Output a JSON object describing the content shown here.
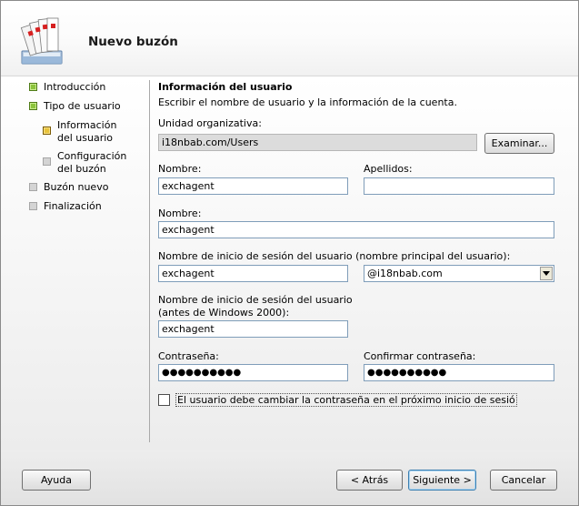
{
  "window": {
    "title": "Nuevo buzón"
  },
  "nav": {
    "items": [
      {
        "label": "Introducción",
        "state": "done"
      },
      {
        "label": "Tipo de usuario",
        "state": "done"
      },
      {
        "label": "Información del usuario",
        "state": "current"
      },
      {
        "label": "Configuración del buzón",
        "state": "pending"
      },
      {
        "label": "Buzón nuevo",
        "state": "pending"
      },
      {
        "label": "Finalización",
        "state": "pending"
      }
    ]
  },
  "form": {
    "section_title": "Información del usuario",
    "section_desc": "Escribir el nombre de usuario y la información de la cuenta.",
    "ou_label": "Unidad organizativa:",
    "ou_value": "i18nbab.com/Users",
    "browse_button": "Examinar...",
    "first_name_label": "Nombre:",
    "first_name_value": "exchagent",
    "last_name_label": "Apellidos:",
    "last_name_value": "",
    "name_label": "Nombre:",
    "name_value": "exchagent",
    "upn_label": "Nombre de inicio de sesión del usuario (nombre principal del usuario):",
    "upn_value": "exchagent",
    "upn_domain": "@i18nbab.com",
    "prew2k_label_1": "Nombre de inicio de sesión del usuario",
    "prew2k_label_2": "(antes de Windows 2000):",
    "prew2k_value": "exchagent",
    "password_label": "Contraseña:",
    "password_value": "●●●●●●●●●●",
    "confirm_label": "Confirmar contraseña:",
    "confirm_value": "●●●●●●●●●●",
    "must_change_label": "El usuario debe cambiar la contraseña en el próximo inicio de sesió",
    "must_change_checked": false
  },
  "footer": {
    "help_button": "Ayuda",
    "back_button": "< Atrás",
    "next_button": "Siguiente >",
    "cancel_button": "Cancelar"
  },
  "colors": {
    "step_done": "#8cc43c",
    "step_current": "#e8c23a",
    "step_pending": "#d4d4d4",
    "input_border": "#7f9db9"
  },
  "icons": {
    "app": "mailbox-wizard-icon"
  }
}
